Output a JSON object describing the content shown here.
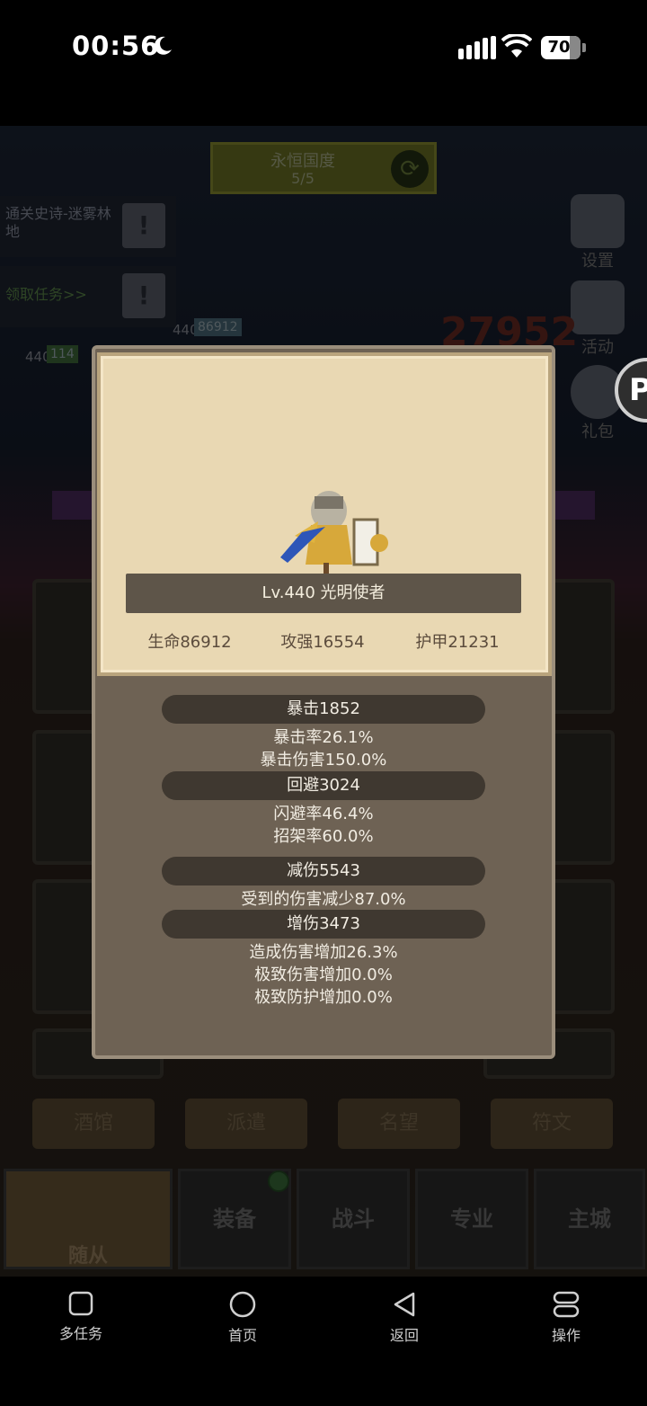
{
  "status_bar": {
    "time": "00:56",
    "battery": "70"
  },
  "game": {
    "region": {
      "name": "永恒国度",
      "progress": "5/5"
    },
    "quests": [
      {
        "text": "通关史诗-迷雾林地"
      },
      {
        "text": "领取任务>>"
      }
    ],
    "side_buttons": [
      {
        "label": "设置"
      },
      {
        "label": "活动"
      },
      {
        "label": "礼包"
      }
    ],
    "floating_icon": "P",
    "score": "27952",
    "enemy_level": "440",
    "enemy_hp": "86912",
    "ally_level": "440",
    "ally_hp": "114",
    "sub_tabs": [
      "酒馆",
      "派遣",
      "名望",
      "符文"
    ],
    "nav": [
      "随从",
      "装备",
      "战斗",
      "专业",
      "主城"
    ]
  },
  "dialog": {
    "hero_name": "Lv.440 光明使者",
    "stats": {
      "hp": "生命86912",
      "atk": "攻强16554",
      "armor": "护甲21231"
    },
    "sections": [
      {
        "title": "暴击1852",
        "lines": [
          "暴击率26.1%",
          "暴击伤害150.0%"
        ]
      },
      {
        "title": "回避3024",
        "lines": [
          "闪避率46.4%",
          "招架率60.0%"
        ]
      },
      {
        "title": "减伤5543",
        "lines": [
          "受到的伤害减少87.0%"
        ]
      },
      {
        "title": "增伤3473",
        "lines": [
          "造成伤害增加26.3%",
          "极致伤害增加0.0%",
          "极致防护增加0.0%"
        ]
      }
    ]
  },
  "system_nav": [
    "多任务",
    "首页",
    "返回",
    "操作"
  ]
}
